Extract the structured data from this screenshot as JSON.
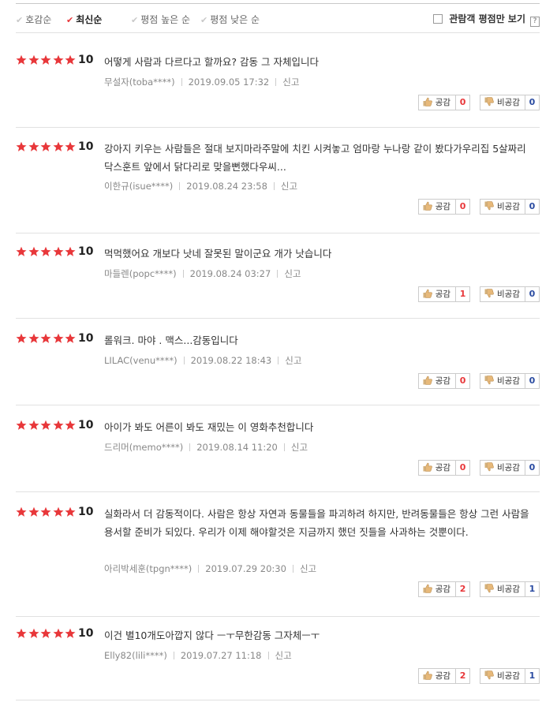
{
  "sort": {
    "options": [
      {
        "label": "호감순",
        "active": false
      },
      {
        "label": "최신순",
        "active": true
      },
      {
        "label": "평점 높은 순",
        "active": false
      },
      {
        "label": "평점 낮은 순",
        "active": false
      }
    ],
    "audience_only_label": "관람객 평점만 보기",
    "help_label": "?"
  },
  "labels": {
    "report": "신고",
    "like": "공감",
    "dislike": "비공감"
  },
  "colors": {
    "star": "#e8373a",
    "like_count": "#e8373a",
    "dislike_count": "#2a4ba1"
  },
  "reviews": [
    {
      "rating": "10",
      "text": "어떻게 사람과 다르다고 할까요? 감동 그 자체입니다",
      "author": "무설자(toba****)",
      "date": "2019.09.05 17:32",
      "likes": "0",
      "dislikes": "0"
    },
    {
      "rating": "10",
      "text": "강아지 키우는 사람들은 절대 보지마라주말에 치킨 시켜놓고 엄마랑 누나랑 같이 봤다가우리집 5살짜리 닥스훈트 앞에서 닭다리로 맞을뻔했다우씨...",
      "author": "이한규(isue****)",
      "date": "2019.08.24 23:58",
      "likes": "0",
      "dislikes": "0"
    },
    {
      "rating": "10",
      "text": "먹먹했어요 개보다 낫네 잘못된 말이군요 개가 낫습니다",
      "author": "마들렌(popc****)",
      "date": "2019.08.24 03:27",
      "likes": "1",
      "dislikes": "0"
    },
    {
      "rating": "10",
      "text": "롤워크. 마야 . 맥스...감동입니다",
      "author": "LILAC(venu****)",
      "date": "2019.08.22 18:43",
      "likes": "0",
      "dislikes": "0"
    },
    {
      "rating": "10",
      "text": "아이가 봐도 어른이 봐도 재밌는 이 영화추천합니다",
      "author": "드리머(memo****)",
      "date": "2019.08.14 11:20",
      "likes": "0",
      "dislikes": "0"
    },
    {
      "rating": "10",
      "text": "실화라서 더 감동적이다. 사람은 항상 자연과 동물들을 파괴하려 하지만, 반려동물들은 항상 그런 사람을 용서할 준비가 되있다. 우리가 이제 해야할것은 지금까지 했던 짓들을 사과하는 것뿐이다.",
      "author": "아리박세훈(tpgn****)",
      "date": "2019.07.29 20:30",
      "likes": "2",
      "dislikes": "1"
    },
    {
      "rating": "10",
      "text": "이건 별10개도아깝지 않다 ㅡㅜ무한감동 그자체ㅡㅜ",
      "author": "Elly82(lili****)",
      "date": "2019.07.27 11:18",
      "likes": "2",
      "dislikes": "1"
    }
  ]
}
